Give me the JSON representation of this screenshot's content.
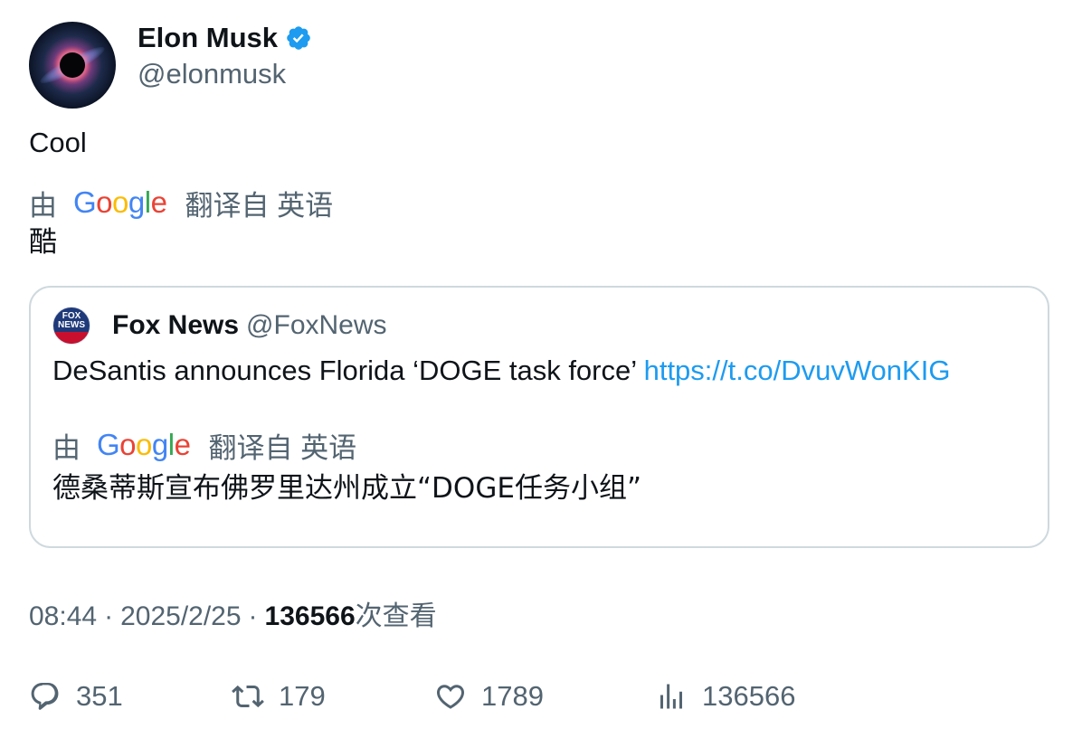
{
  "author": {
    "display_name": "Elon Musk",
    "handle": "@elonmusk",
    "verified_color": "#1d9bf0",
    "avatar_icon": "galaxy-avatar"
  },
  "tweet": {
    "text": "Cool",
    "translation": {
      "by_label": "由",
      "provider": "Google",
      "from_label": "翻译自 英语",
      "text": "酷"
    }
  },
  "quote": {
    "display_name": "Fox News",
    "handle": "@FoxNews",
    "avatar_text_top": "FOX",
    "avatar_text_mid": "NEWS",
    "text": "DeSantis announces Florida ‘DOGE task force’ ",
    "link": "https://t.co/DvuvWonKIG",
    "translation": {
      "by_label": "由",
      "provider": "Google",
      "from_label": "翻译自 英语",
      "text": "德桑蒂斯宣布佛罗里达州成立“DOGE任务小组”"
    }
  },
  "meta": {
    "time": "08:44",
    "date": "2025/2/25",
    "separator": "·",
    "views": "136566",
    "views_label": "次查看"
  },
  "actions": {
    "replies": "351",
    "reposts": "179",
    "likes": "1789",
    "views": "136566"
  },
  "colors": {
    "text_primary": "#0f1419",
    "text_secondary": "#536471",
    "link": "#1d9bf0",
    "border": "#cfd9de"
  }
}
